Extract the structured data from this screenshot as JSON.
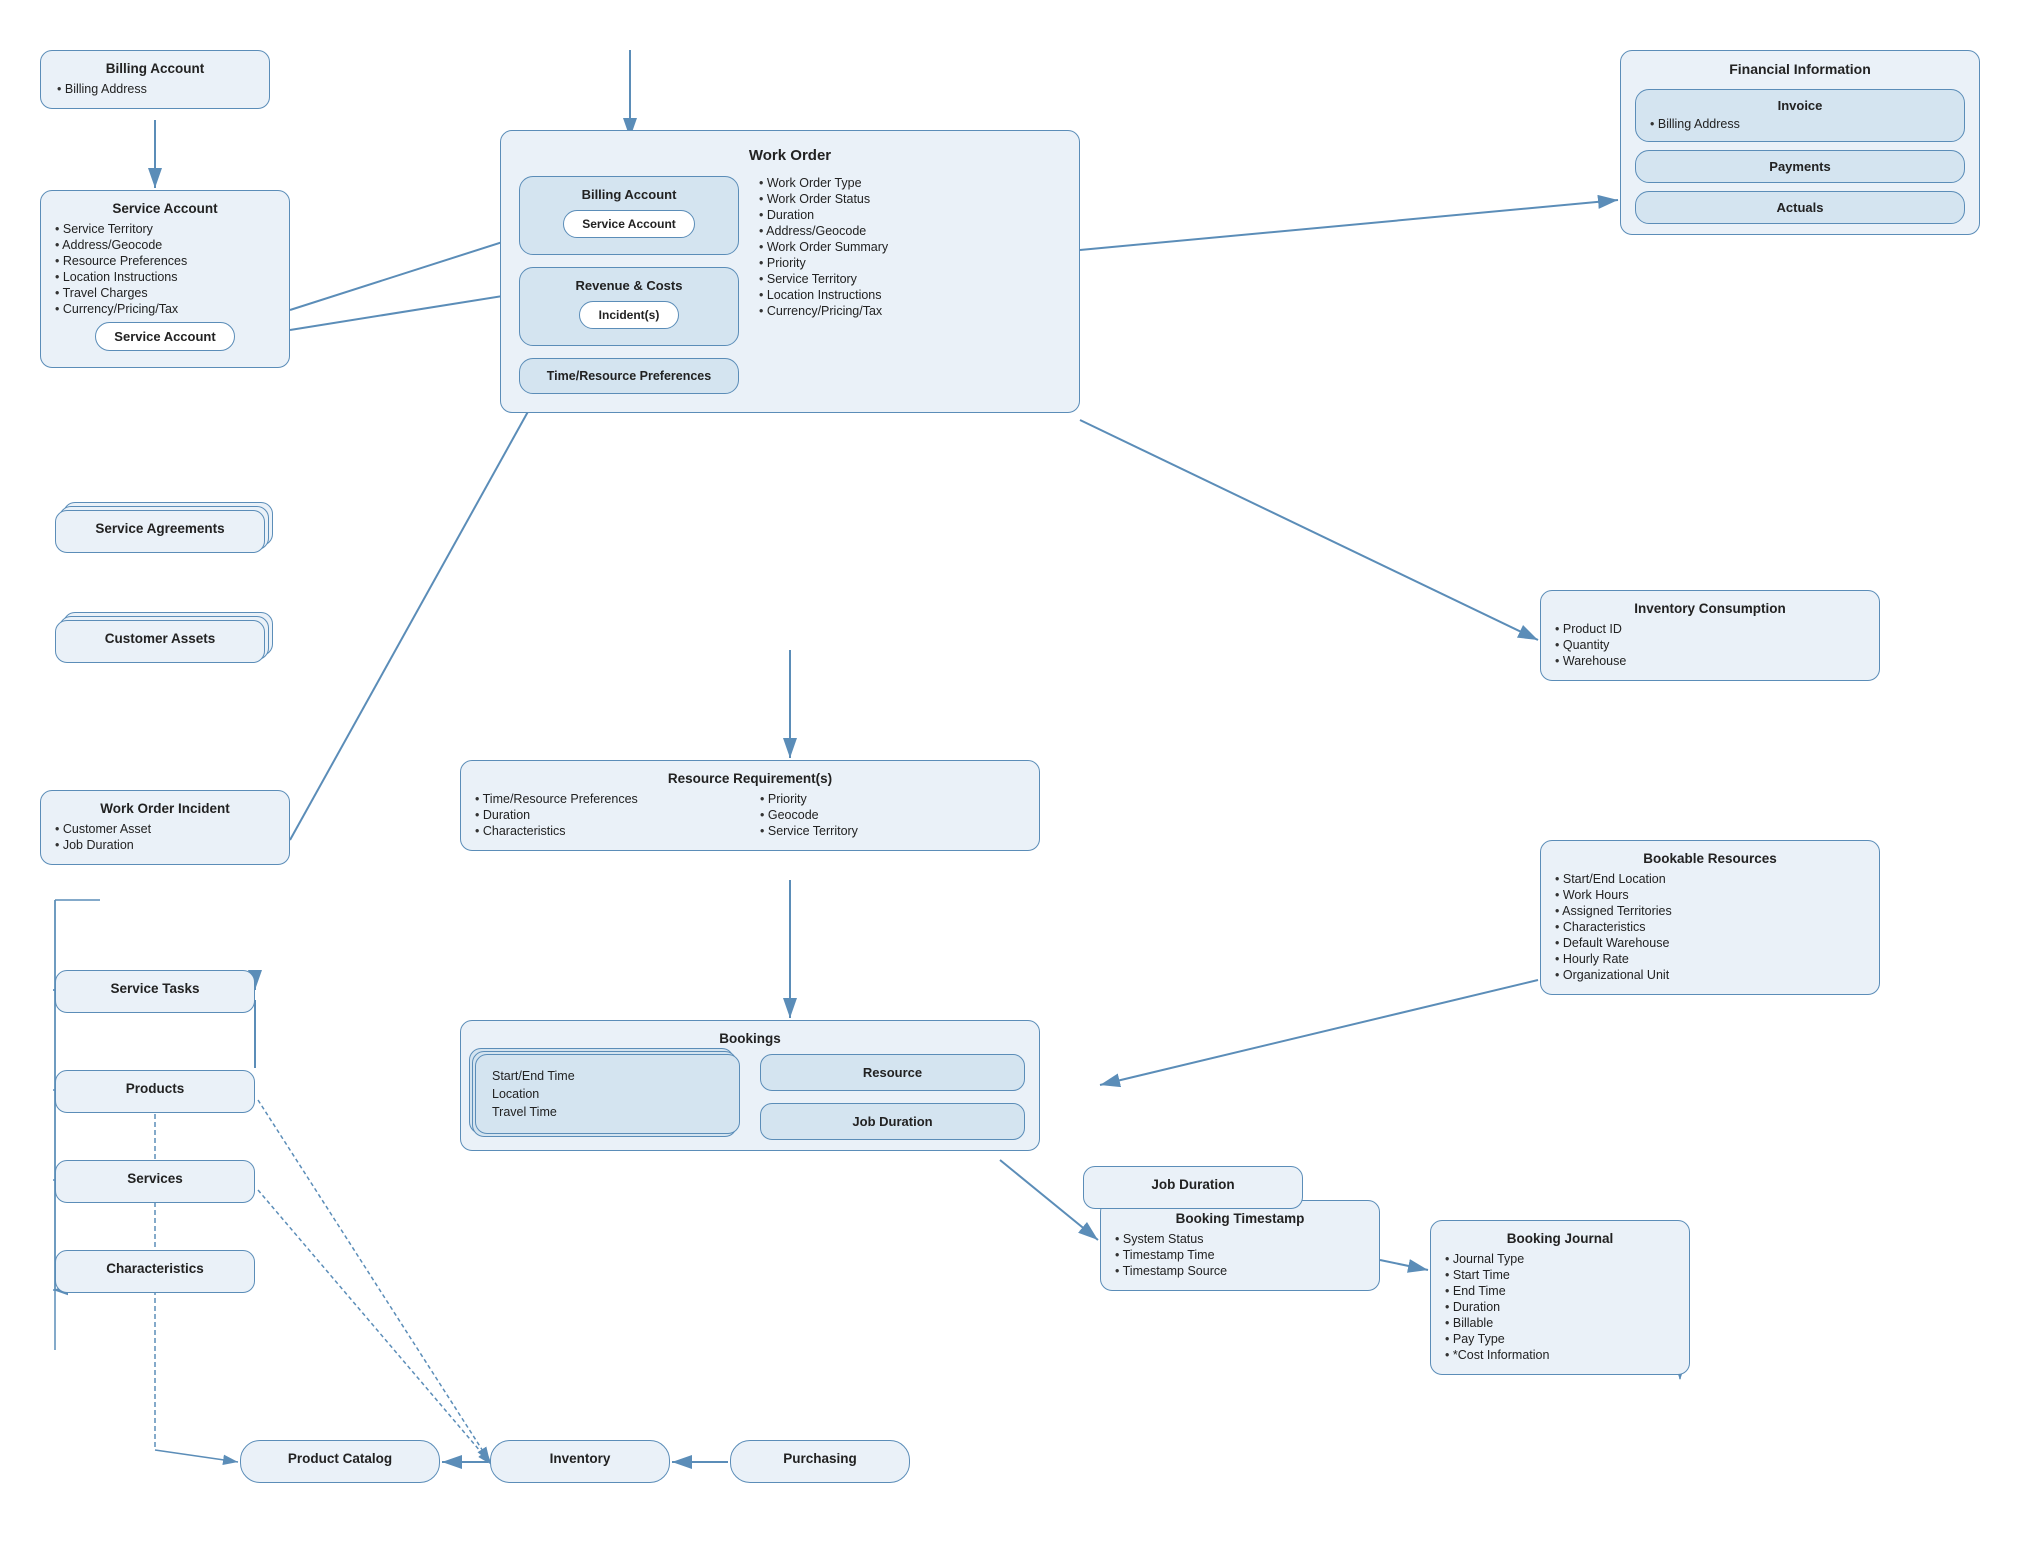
{
  "billing_account_top": {
    "title": "Billing Account",
    "items": [
      "Billing Address"
    ]
  },
  "service_account": {
    "title": "Service Account",
    "items": [
      "Service Territory",
      "Address/Geocode",
      "Resource Preferences",
      "Location Instructions",
      "Travel Charges",
      "Currency/Pricing/Tax"
    ],
    "inner": "Service Account"
  },
  "service_agreements": {
    "title": "Service Agreements"
  },
  "customer_assets": {
    "title": "Customer Assets"
  },
  "work_order_incident": {
    "title": "Work Order Incident",
    "items": [
      "Customer Asset",
      "Job Duration"
    ]
  },
  "service_tasks": {
    "title": "Service Tasks"
  },
  "products": {
    "title": "Products"
  },
  "services": {
    "title": "Services"
  },
  "characteristics_left": {
    "title": "Characteristics"
  },
  "product_catalog": {
    "title": "Product Catalog"
  },
  "inventory": {
    "title": "Inventory"
  },
  "purchasing": {
    "title": "Purchasing"
  },
  "financial_info": {
    "title": "Financial Information",
    "invoice": {
      "title": "Invoice",
      "items": [
        "Billing Address"
      ]
    },
    "payments": "Payments",
    "actuals": "Actuals"
  },
  "inventory_consumption": {
    "title": "Inventory Consumption",
    "items": [
      "Product ID",
      "Quantity",
      "Warehouse"
    ]
  },
  "bookable_resources": {
    "title": "Bookable Resources",
    "items": [
      "Start/End Location",
      "Work Hours",
      "Assigned Territories",
      "Characteristics",
      "Default Warehouse",
      "Hourly Rate",
      "Organizational Unit"
    ]
  },
  "work_order": {
    "title": "Work Order",
    "billing_account": "Billing Account",
    "service_account": "Service Account",
    "revenue_costs": "Revenue & Costs",
    "incidents": "Incident(s)",
    "time_resource": "Time/Resource Preferences",
    "items": [
      "Work Order Type",
      "Work Order Status",
      "Duration",
      "Address/Geocode",
      "Work Order Summary",
      "Priority",
      "Service Territory",
      "Location Instructions",
      "Currency/Pricing/Tax"
    ]
  },
  "resource_req": {
    "title": "Resource Requirement(s)",
    "col1": [
      "Time/Resource Preferences",
      "Duration",
      "Characteristics"
    ],
    "col2": [
      "Priority",
      "Geocode",
      "Service Territory"
    ]
  },
  "bookings": {
    "title": "Bookings",
    "left_items": [
      "Start/End Time",
      "Location",
      "Travel Time"
    ],
    "resource": "Resource",
    "job_duration": "Job Duration"
  },
  "booking_timestamp": {
    "title": "Booking Timestamp",
    "items": [
      "System Status",
      "Timestamp Time",
      "Timestamp Source"
    ]
  },
  "booking_journal": {
    "title": "Booking Journal",
    "items": [
      "Journal Type",
      "Start Time",
      "End Time",
      "Duration",
      "Billable",
      "Pay Type",
      "*Cost Information"
    ]
  }
}
